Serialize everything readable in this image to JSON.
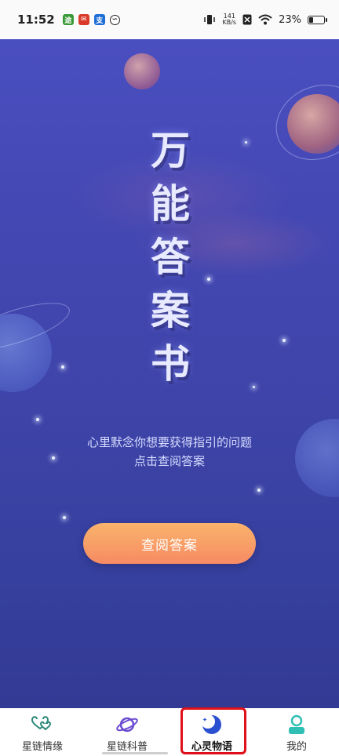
{
  "status_bar": {
    "time": "11:52",
    "app_icons": [
      "app-icon-green",
      "app-icon-red",
      "app-icon-blue",
      "app-icon-link"
    ],
    "net_speed_value": "141",
    "net_speed_unit": "KB/s",
    "battery_percent": "23%"
  },
  "main": {
    "title_chars": [
      "万",
      "能",
      "答",
      "案",
      "书"
    ],
    "prompt_line1": "心里默念你想要获得指引的问题",
    "prompt_line2": "点击查阅答案",
    "cta_label": "查阅答案"
  },
  "bottom_nav": {
    "items": [
      {
        "label": "星链情缘",
        "icon": "hearts-icon",
        "color": "#2d8a7a"
      },
      {
        "label": "星链科普",
        "icon": "planet-icon",
        "color": "#6a4bd0"
      },
      {
        "label": "心灵物语",
        "icon": "moon-icon",
        "color": "#2a4fd0"
      },
      {
        "label": "我的",
        "icon": "user-icon",
        "color": "#2fbfb4"
      }
    ],
    "active_index": 2
  },
  "colors": {
    "accent_orange": "#f78a63",
    "highlight_red": "#e0101a",
    "bg_blue": "#4448b4"
  }
}
